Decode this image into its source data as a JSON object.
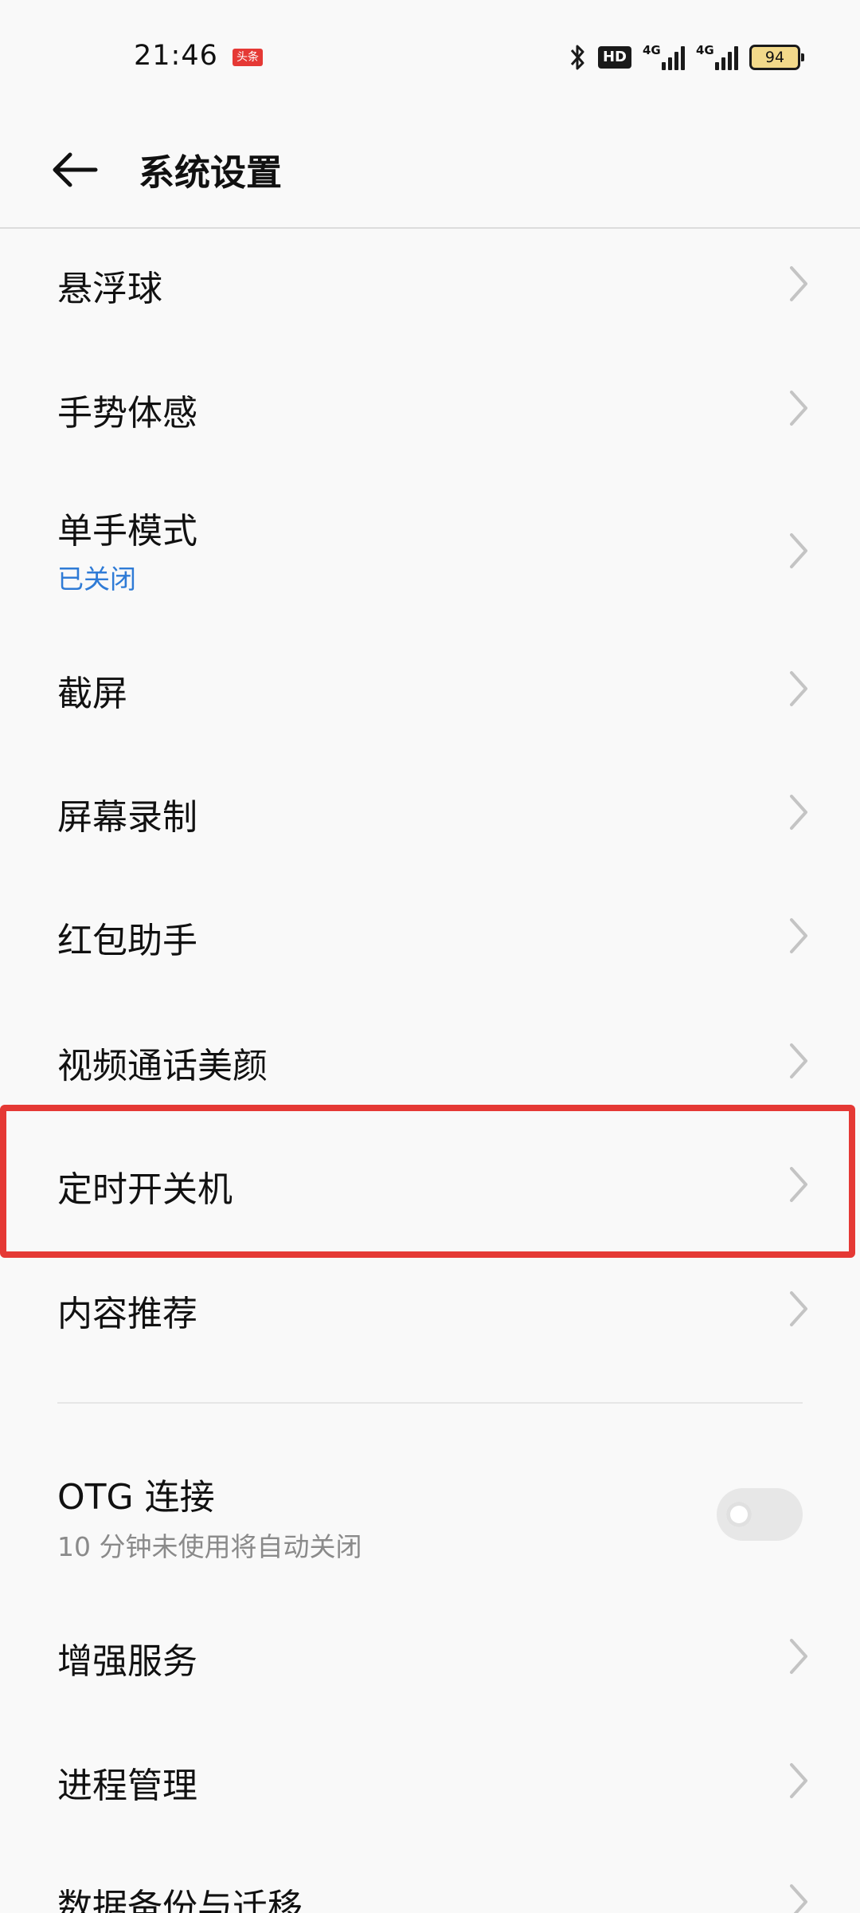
{
  "status_bar": {
    "time": "21:46",
    "news_badge": "头条",
    "hd": "HD",
    "signal1_net": "4G",
    "signal2_net": "4G",
    "battery": "94",
    "battery_color": "#f2d98a"
  },
  "header": {
    "back_icon": "arrow-left-icon",
    "title": "系统设置"
  },
  "colors": {
    "accent_blue": "#2f7bd6",
    "highlight_red": "#e53935",
    "secondary_text": "#8a8a8a"
  },
  "menu": {
    "items": [
      {
        "label": "悬浮球"
      },
      {
        "label": "手势体感"
      },
      {
        "label": "单手模式",
        "status": "已关闭"
      },
      {
        "label": "截屏"
      },
      {
        "label": "屏幕录制"
      },
      {
        "label": "红包助手"
      },
      {
        "label": "视频通话美颜"
      },
      {
        "label": "定时开关机"
      },
      {
        "label": "内容推荐"
      }
    ],
    "otg": {
      "label": "OTG 连接",
      "description": "10 分钟未使用将自动关闭",
      "enabled": false
    },
    "items2": [
      {
        "label": "增强服务"
      },
      {
        "label": "进程管理"
      },
      {
        "label": "数据备份与迁移"
      }
    ]
  }
}
